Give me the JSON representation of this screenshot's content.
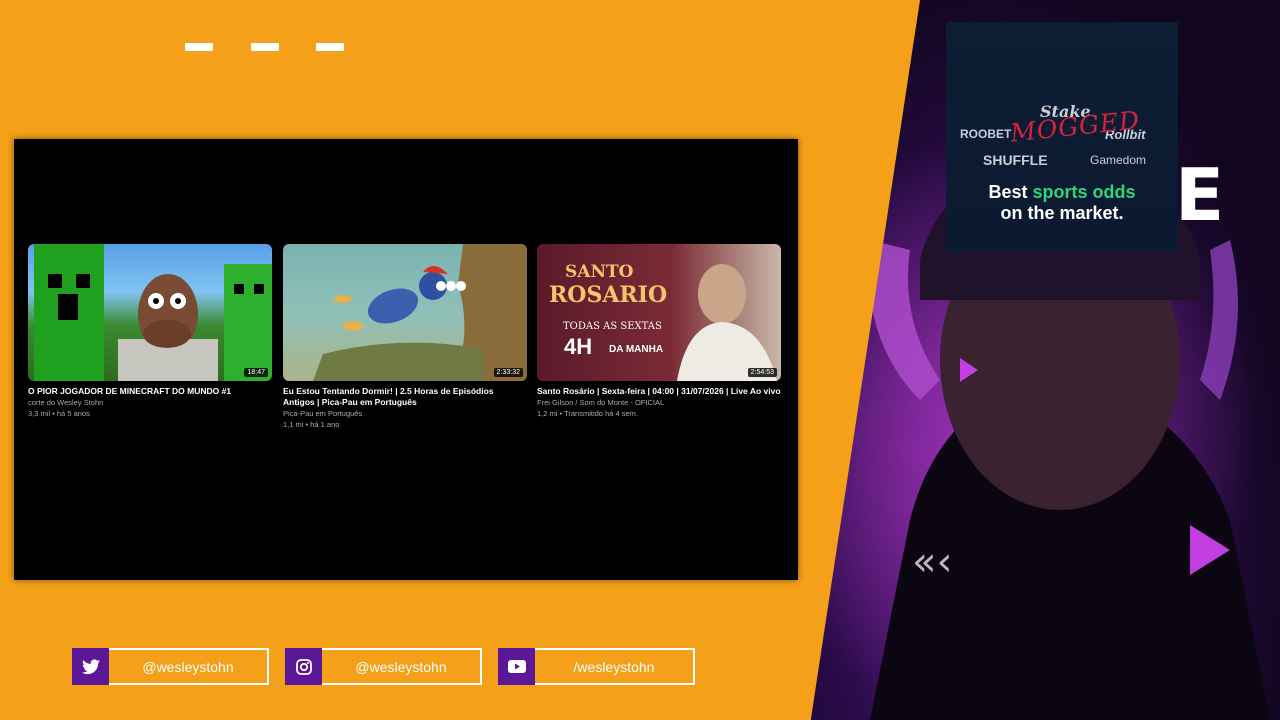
{
  "videos": [
    {
      "title": "O PIOR JOGADOR DE MINECRAFT DO MUNDO #1",
      "channel": "corte do Wesley Stohn",
      "meta": "3,3 mil • há 5 anos",
      "duration": "18:47"
    },
    {
      "title": "Eu Estou Tentando Dormir! | 2.5 Horas de Episódios Antigos | Pica-Pau em Português",
      "channel": "Pica-Pau em Português",
      "meta": "1,1 mi • há 1 ano",
      "duration": "2:33:32"
    },
    {
      "title": "Santo Rosário | Sexta-feira | 04:00 | 31/07/2026 | Live Ao vivo",
      "channel": "Frei Gilson / Som do Monte - OFICIAL",
      "meta": "1,2 mi • Transmitido há 4 sem.",
      "duration": "2:54:53"
    }
  ],
  "thumb3": {
    "line1": "SANTO",
    "line2": "ROSARIO",
    "line3": "TODAS AS SEXTAS",
    "line4": "4H",
    "line5": "DA MANHA"
  },
  "ad": {
    "brand_stake": "Stake",
    "brand_roobet": "ROOBET",
    "brand_rollbit": "Rollbit",
    "brand_shuffle": "SHUFFLE",
    "brand_gamedom": "Gamedom",
    "overlay": "MOGGED",
    "line1_a": "Best ",
    "line1_b": "sports odds",
    "line2": "on the market."
  },
  "socials": [
    {
      "icon": "twitter-icon",
      "handle": "@wesleystohn"
    },
    {
      "icon": "instagram-icon",
      "handle": "@wesleystohn"
    },
    {
      "icon": "youtube-icon",
      "handle": "/wesleystohn"
    }
  ],
  "colors": {
    "background": "#F4A018",
    "accent": "#5b1798",
    "ad_highlight": "#2fd47a",
    "overlay_red": "#e0243c"
  }
}
